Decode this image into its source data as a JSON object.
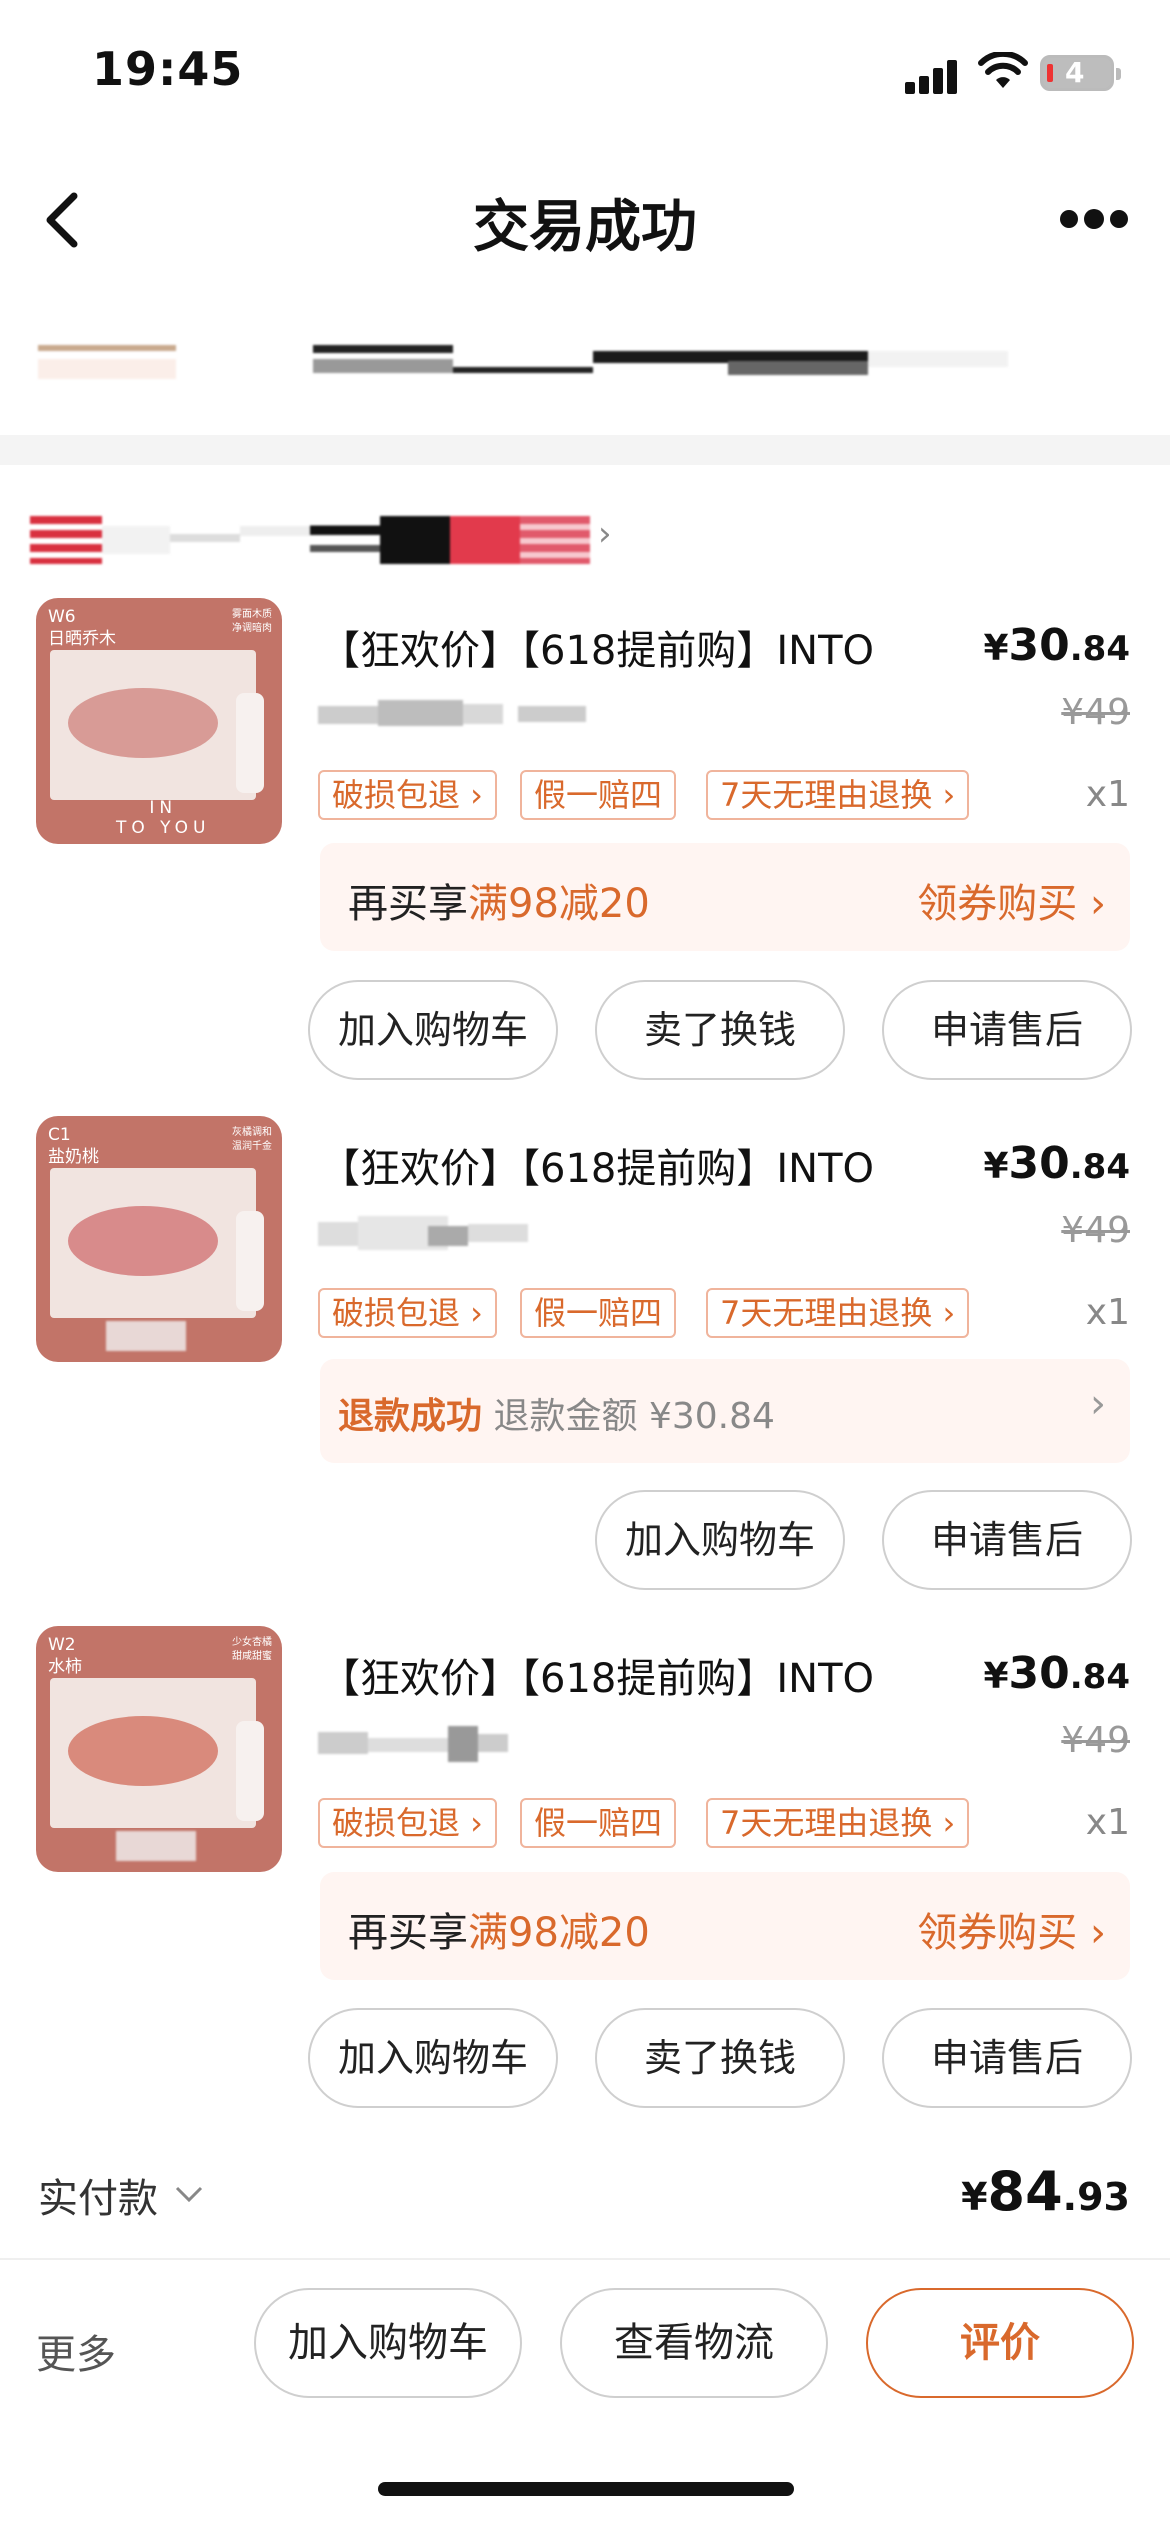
{
  "status_bar": {
    "time": "19:45",
    "battery": "4"
  },
  "nav": {
    "title": "交易成功"
  },
  "products": [
    {
      "thumb": {
        "code": "W6",
        "name": "日晒乔木",
        "tagline": "雾面木质\n净调暗肉",
        "brand": "IN\nTO YOU"
      },
      "title": "【狂欢价】【618提前购】INTO",
      "price": {
        "symbol": "¥",
        "int": "30",
        "dec": ".84"
      },
      "original_price": "¥49",
      "tags": [
        "破损包退 ›",
        "假一赔四",
        "7天无理由退换 ›"
      ],
      "qty": "x1",
      "promo": {
        "prefix": "再买享",
        "highlight": "满98减20",
        "action": "领券购买 ›"
      },
      "buttons": [
        "加入购物车",
        "卖了换钱",
        "申请售后"
      ]
    },
    {
      "thumb": {
        "code": "C1",
        "name": "盐奶桃",
        "tagline": "灰橘调和\n温润千金",
        "brand": ""
      },
      "title": "【狂欢价】【618提前购】INTO",
      "price": {
        "symbol": "¥",
        "int": "30",
        "dec": ".84"
      },
      "original_price": "¥49",
      "tags": [
        "破损包退 ›",
        "假一赔四",
        "7天无理由退换 ›"
      ],
      "qty": "x1",
      "refund": {
        "status": "退款成功",
        "label": "退款金额",
        "amount": "¥30.84",
        "chevron": "›"
      },
      "buttons": [
        "加入购物车",
        "申请售后"
      ]
    },
    {
      "thumb": {
        "code": "W2",
        "name": "水柿",
        "tagline": "少女杏橘\n甜咸甜蜜",
        "brand": ""
      },
      "title": "【狂欢价】【618提前购】INTO",
      "price": {
        "symbol": "¥",
        "int": "30",
        "dec": ".84"
      },
      "original_price": "¥49",
      "tags": [
        "破损包退 ›",
        "假一赔四",
        "7天无理由退换 ›"
      ],
      "qty": "x1",
      "promo": {
        "prefix": "再买享",
        "highlight": "满98减20",
        "action": "领券购买 ›"
      },
      "buttons": [
        "加入购物车",
        "卖了换钱",
        "申请售后"
      ]
    }
  ],
  "summary": {
    "label": "实付款",
    "symbol": "¥",
    "int": "84",
    "dec": ".93"
  },
  "bottom_bar": {
    "more": "更多",
    "buttons": [
      "加入购物车",
      "查看物流",
      "评价"
    ]
  }
}
